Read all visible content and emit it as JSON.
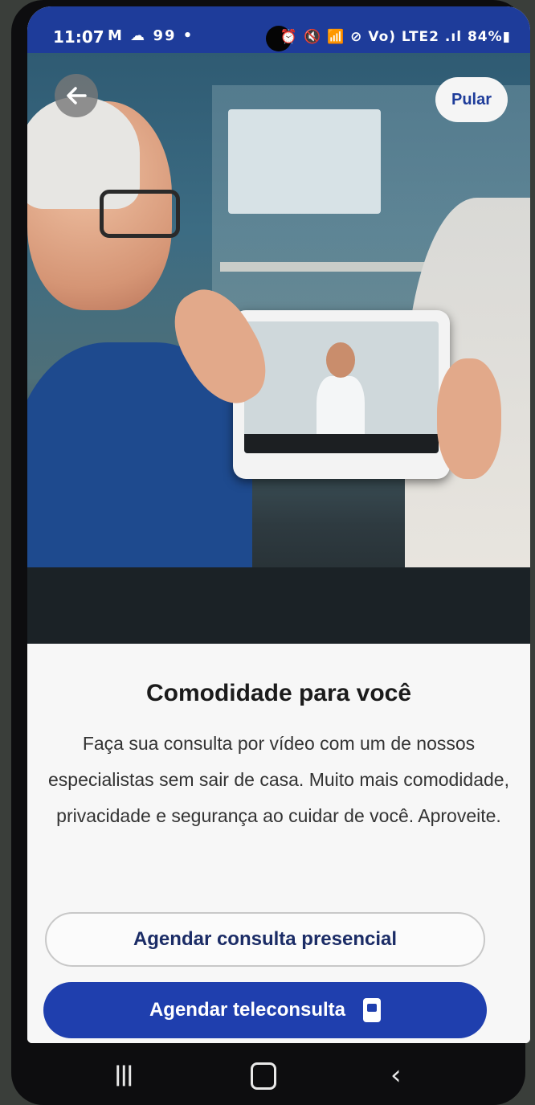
{
  "status_bar": {
    "time": "11:07",
    "left_icons": "M ☁ 99 •",
    "right_icons": "⏰ 🔇 📶 ⊘ Vo) LTE2 .ıl 84%▮",
    "battery": "84%"
  },
  "header": {
    "back_icon": "arrow-left-icon",
    "skip_label": "Pular"
  },
  "main": {
    "title": "Comodidade para você",
    "description": "Faça sua consulta por vídeo com um de nossos especialistas sem sair de casa. Muito mais comodidade, privacidade e segurança ao cuidar de você. Aproveite.",
    "buttons": {
      "in_person": "Agendar consulta presencial",
      "teleconsult": "Agendar teleconsulta",
      "teleconsult_icon": "phone-video-icon"
    }
  },
  "nav_bar": {
    "recent_icon": "recent-apps-icon",
    "home_icon": "home-icon",
    "back_icon": "back-icon"
  },
  "colors": {
    "brand_blue": "#1f3fae",
    "status_bar": "#1e3c9a",
    "text_dark": "#1b1b1b"
  }
}
